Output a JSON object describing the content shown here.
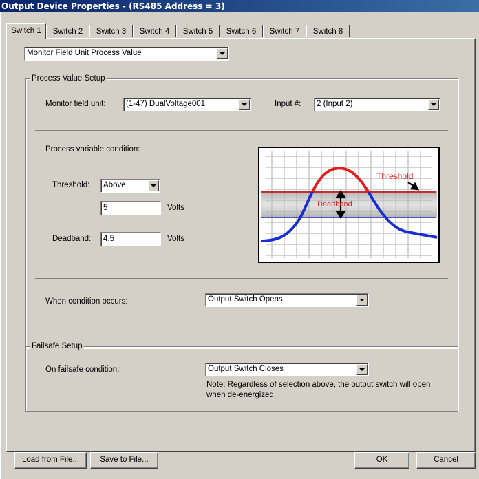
{
  "window": {
    "title": "Output Device Properties -  (RS485 Address = 3)"
  },
  "tabs": [
    "Switch 1",
    "Switch 2",
    "Switch 3",
    "Switch 4",
    "Switch 5",
    "Switch 6",
    "Switch 7",
    "Switch 8"
  ],
  "mode_select": {
    "value": "Monitor Field Unit Process Value"
  },
  "process_setup": {
    "group_label": "Process Value Setup",
    "monitor_label": "Monitor field unit:",
    "monitor_value": "(1-47) DualVoltage001",
    "input_label": "Input #:",
    "input_value": "2 (Input 2)",
    "condition_label": "Process variable condition:",
    "threshold_label": "Threshold:",
    "threshold_mode": "Above",
    "threshold_value": "5",
    "threshold_unit": "Volts",
    "deadband_label": "Deadband:",
    "deadband_value": "4.5",
    "deadband_unit": "Volts",
    "when_label": "When condition occurs:",
    "when_value": "Output Switch Opens"
  },
  "diagram": {
    "threshold_text": "Threshold",
    "deadband_text": "Deadband",
    "curve_color_high": "#e02020",
    "curve_color_low": "#1a2ed0",
    "threshold_line_color": "#cc0000",
    "lower_line_color": "#1020b0"
  },
  "failsafe": {
    "group_label": "Failsafe Setup",
    "condition_label": "On failsafe condition:",
    "condition_value": "Output Switch Closes",
    "note": "Note: Regardless of selection above, the output switch will open when de-energized."
  },
  "buttons": {
    "load": "Load from File...",
    "save": "Save to File...",
    "ok": "OK",
    "cancel": "Cancel"
  }
}
